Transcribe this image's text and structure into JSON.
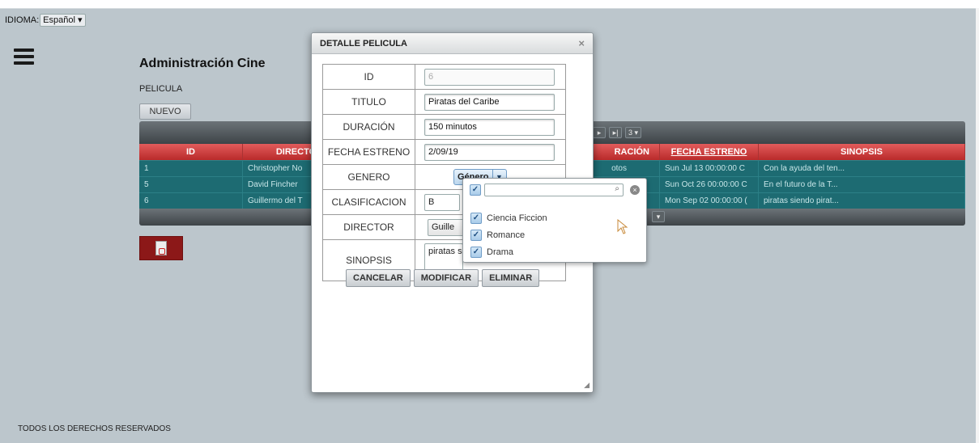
{
  "lang": {
    "label": "IDIOMA:",
    "selected": "Español"
  },
  "header": {
    "title": "Administración Cine",
    "section": "PELICULA",
    "new_button": "NUEVO"
  },
  "grid": {
    "pager": {
      "last_icon": "▸|",
      "page_size": "3"
    },
    "columns": [
      "ID",
      "DIRECTO",
      "RACIÓN",
      "FECHA ESTRENO",
      "SINOPSIS"
    ],
    "rows": [
      [
        "1",
        "Christopher No",
        "otos",
        "Sun Jul 13 00:00:00 C",
        "Con la ayuda del ten..."
      ],
      [
        "5",
        "David Fincher",
        "",
        "Sun Oct 26 00:00:00 C",
        "En el futuro de la T..."
      ],
      [
        "6",
        "Guillermo del T",
        "",
        "Mon Sep 02 00:00:00 (",
        "piratas siendo pirat..."
      ]
    ]
  },
  "modal": {
    "title": "DETALLE PELICULA",
    "close": "×",
    "fields": {
      "id": {
        "label": "ID",
        "value": "6"
      },
      "titulo": {
        "label": "TITULO",
        "value": "Piratas del Caribe"
      },
      "duracion": {
        "label": "DURACIÓN",
        "value": "150 minutos"
      },
      "fecha": {
        "label": "FECHA ESTRENO",
        "value": "2/09/19"
      },
      "genero": {
        "label": "GENERO",
        "button": "Género"
      },
      "clasificacion": {
        "label": "CLASIFICACION",
        "value": "B"
      },
      "director": {
        "label": "DIRECTOR",
        "value": "Guille"
      },
      "sinopsis": {
        "label": "SINOPSIS",
        "value": "piratas s"
      }
    },
    "buttons": {
      "cancel": "CANCELAR",
      "modify": "MODIFICAR",
      "delete": "ELIMINAR"
    }
  },
  "genre_dropdown": {
    "options": [
      {
        "label": "Ciencia Ficcion",
        "checked": true
      },
      {
        "label": "Romance",
        "checked": true
      },
      {
        "label": "Drama",
        "checked": true
      }
    ]
  },
  "footer": {
    "text": "TODOS LOS DERECHOS RESERVADOS"
  }
}
